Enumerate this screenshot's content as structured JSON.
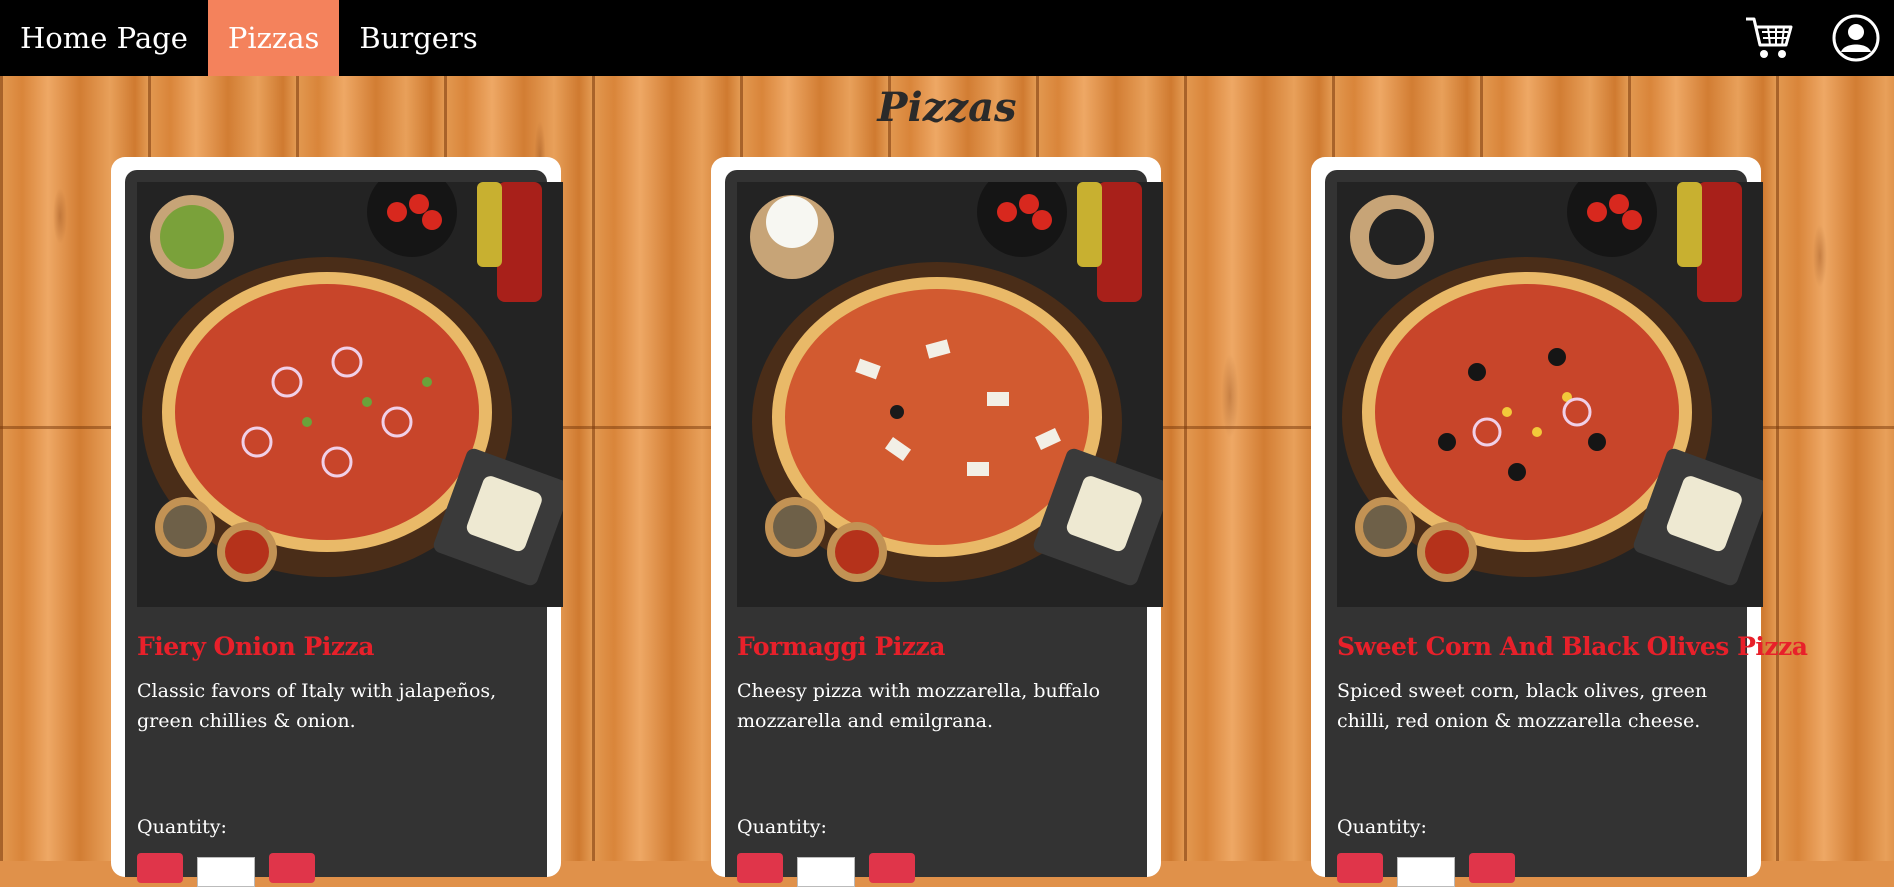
{
  "nav": {
    "items": [
      {
        "label": "Home Page",
        "active": false
      },
      {
        "label": "Pizzas",
        "active": true
      },
      {
        "label": "Burgers",
        "active": false
      }
    ],
    "cart_icon": "cart-icon",
    "account_icon": "user-account-icon",
    "active_color": "#f4825c"
  },
  "page": {
    "title": "Pizzas"
  },
  "products": [
    {
      "name": "Fiery Onion Pizza",
      "description": "Classic favors of Italy with jalapeños, green chillies & onion.",
      "quantity_label": "Quantity:",
      "topping": "onion"
    },
    {
      "name": "Formaggi Pizza",
      "description": "Cheesy pizza with mozzarella, buffalo mozzarella and emilgrana.",
      "quantity_label": "Quantity:",
      "topping": "cheese"
    },
    {
      "name": "Sweet Corn And Black Olives Pizza",
      "description": "Spiced sweet corn, black olives, green chilli, red onion & mozzarella cheese.",
      "quantity_label": "Quantity:",
      "topping": "olives"
    }
  ],
  "colors": {
    "title_red": "#e8202a",
    "button_red": "#e0354a",
    "card_dark": "#333333"
  }
}
